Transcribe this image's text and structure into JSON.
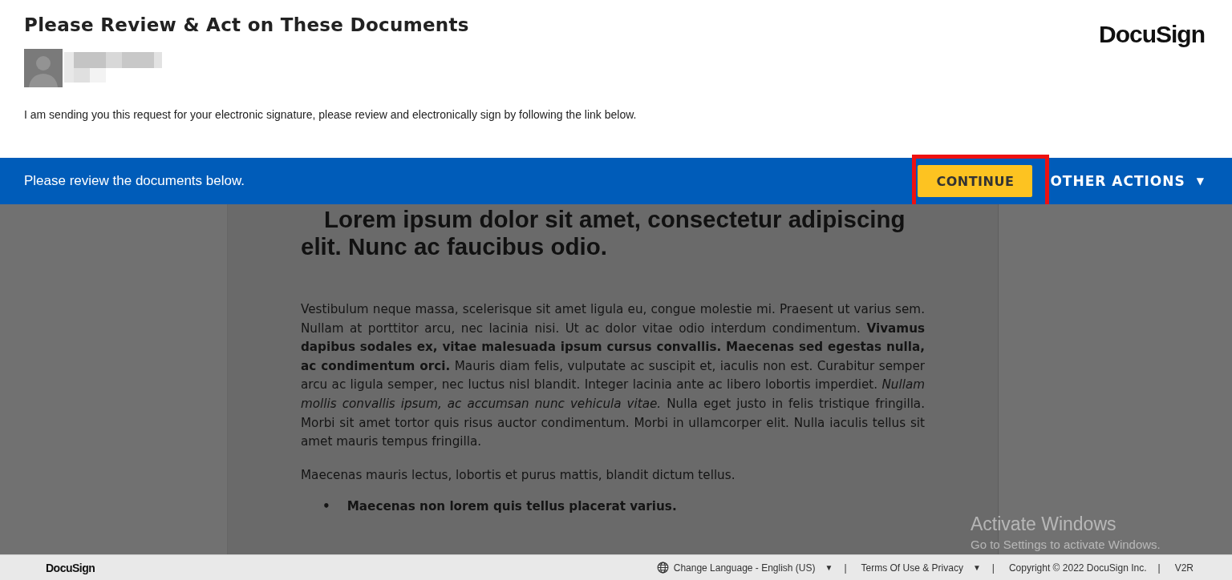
{
  "header": {
    "title": "Please Review & Act on These Documents",
    "logo": "DocuSign",
    "sender": {
      "name_hidden": true
    },
    "message": "I am sending you this request for your electronic signature, please review and electronically sign by following the link below."
  },
  "action_bar": {
    "text": "Please review the documents below.",
    "continue_button": {
      "label": "CONTINUE",
      "highlighted": true
    },
    "other_actions": {
      "label": "OTHER ACTIONS",
      "caret": "▼"
    }
  },
  "document": {
    "heading": "Lorem ipsum dolor sit amet, consectetur adipiscing elit. Nunc ac faucibus odio.",
    "paragraphs": [
      "Vestibulum neque massa, scelerisque sit amet ligula eu, congue molestie mi. Praesent ut varius sem. Nullam at porttitor arcu, nec lacinia nisi. Ut ac dolor vitae odio interdum condimentum. **Vivamus dapibus sodales ex, vitae malesuada ipsum cursus convallis. Maecenas sed egestas nulla, ac condimentum orci.** Mauris diam felis, vulputate ac suscipit et, iaculis non est. Curabitur semper arcu ac ligula semper, nec luctus nisl blandit. Integer lacinia ante ac libero lobortis imperdiet. *Nullam mollis convallis ipsum, ac accumsan nunc vehicula vitae.* Nulla eget justo in felis tristique fringilla. Morbi sit amet tortor quis risus auctor condimentum. Morbi in ullamcorper elit. Nulla iaculis tellus sit amet mauris tempus fringilla.",
      "Maecenas mauris lectus, lobortis et purus mattis, blandit dictum tellus."
    ],
    "bullets": [
      {
        "marker": "•",
        "text": "Maecenas non lorem quis tellus placerat varius."
      }
    ]
  },
  "os_overlay": {
    "title": "Activate Windows",
    "subtitle": "Go to Settings to activate Windows."
  },
  "footer": {
    "logo": "DocuSign",
    "items": [
      {
        "kind": "language",
        "label": "Change Language - English (US)",
        "caret": "▼"
      },
      {
        "kind": "separator",
        "label": "|"
      },
      {
        "kind": "menu",
        "label": "Terms Of Use & Privacy",
        "caret": "▼"
      },
      {
        "kind": "separator",
        "label": "|"
      },
      {
        "kind": "text",
        "label": "Copyright © 2022 DocuSign Inc."
      },
      {
        "kind": "separator",
        "label": "|"
      },
      {
        "kind": "text",
        "label": "V2R"
      }
    ]
  }
}
